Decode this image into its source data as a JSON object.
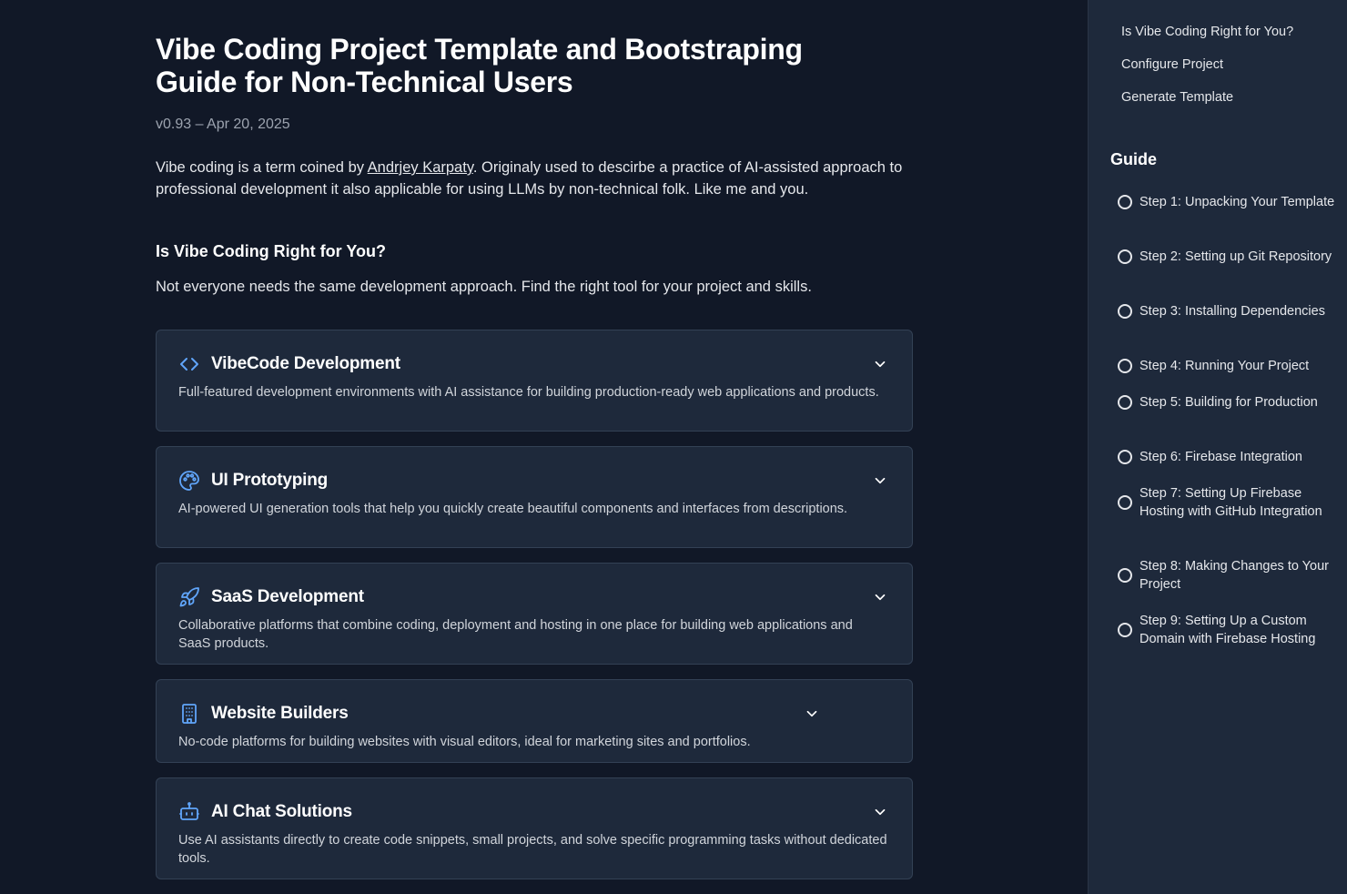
{
  "page": {
    "title_line1": "Vibe Coding Project Template and Bootstraping",
    "title_line2": "Guide for Non-Technical Users",
    "version": "v0.93 – Apr 20, 2025",
    "intro_before": "Vibe coding is a term coined by ",
    "intro_link": "Andrjey Karpaty",
    "intro_after": ". Originaly used to descirbe a practice of AI-assisted approach to professional development it also applicable for using LLMs by non-technical folk. Like me and you.",
    "section_title": "Is Vibe Coding Right for You?",
    "section_desc": "Not everyone needs the same development approach. Find the right tool for your project and skills."
  },
  "cards": [
    {
      "icon": "code-icon",
      "title": "VibeCode Development",
      "desc": "Full-featured development environments with AI assistance for building production-ready web applications and products."
    },
    {
      "icon": "palette-icon",
      "title": "UI Prototyping",
      "desc": "AI-powered UI generation tools that help you quickly create beautiful components and interfaces from descriptions."
    },
    {
      "icon": "rocket-icon",
      "title": "SaaS Development",
      "desc": "Collaborative platforms that combine coding, deployment and hosting in one place for building web applications and SaaS products."
    },
    {
      "icon": "building-icon",
      "title": "Website Builders",
      "desc": "No-code platforms for building websites with visual editors, ideal for marketing sites and portfolios."
    },
    {
      "icon": "bot-icon",
      "title": "AI Chat Solutions",
      "desc": "Use AI assistants directly to create code snippets, small projects, and solve specific programming tasks without dedicated tools."
    }
  ],
  "sidebar": {
    "toc": [
      "Is Vibe Coding Right for You?",
      "Configure Project",
      "Generate Template"
    ],
    "guide_title": "Guide",
    "steps": [
      "Step 1: Unpacking Your Template",
      "Step 2: Setting up Git Repository",
      "Step 3: Installing Dependencies",
      "Step 4: Running Your Project",
      "Step 5: Building for Production",
      "Step 6: Firebase Integration",
      "Step 7: Setting Up Firebase Hosting with GitHub Integration",
      "Step 8: Making Changes to Your Project",
      "Step 9: Setting Up a Custom Domain with Firebase Hosting"
    ]
  },
  "colors": {
    "accent": "#60a5fa",
    "background": "#111827",
    "card": "#1e293b"
  }
}
